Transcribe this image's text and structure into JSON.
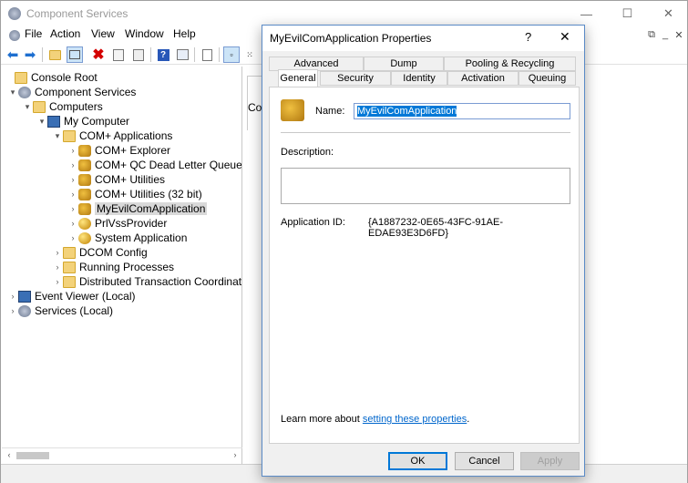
{
  "window": {
    "title": "Component Services",
    "menu": [
      "File",
      "Action",
      "View",
      "Window",
      "Help"
    ]
  },
  "tree": [
    {
      "label": "Console Root",
      "icon": "folder-icon",
      "exp": ""
    },
    {
      "label": "Component Services",
      "icon": "gear-icon",
      "exp": "▾"
    },
    {
      "label": "Computers",
      "icon": "folder-icon",
      "exp": "▾"
    },
    {
      "label": "My Computer",
      "icon": "computer-icon",
      "exp": "▾"
    },
    {
      "label": "COM+ Applications",
      "icon": "folder-icon",
      "exp": "▾"
    },
    {
      "label": "COM+ Explorer",
      "icon": "component-icon",
      "exp": "›"
    },
    {
      "label": "COM+ QC Dead Letter Queue Lis",
      "icon": "component-icon",
      "exp": "›"
    },
    {
      "label": "COM+ Utilities",
      "icon": "component-icon",
      "exp": "›"
    },
    {
      "label": "COM+ Utilities (32 bit)",
      "icon": "component-icon",
      "exp": "›"
    },
    {
      "label": "MyEvilComApplication",
      "icon": "component-icon",
      "exp": "›"
    },
    {
      "label": "PrlVssProvider",
      "icon": "ball-icon",
      "exp": "›"
    },
    {
      "label": "System Application",
      "icon": "ball-icon",
      "exp": "›"
    },
    {
      "label": "DCOM Config",
      "icon": "folder-icon",
      "exp": "›"
    },
    {
      "label": "Running Processes",
      "icon": "folder-icon",
      "exp": "›"
    },
    {
      "label": "Distributed Transaction Coordinator",
      "icon": "folder-icon",
      "exp": "›"
    },
    {
      "label": "Event Viewer (Local)",
      "icon": "event-viewer-icon",
      "exp": "›"
    },
    {
      "label": "Services (Local)",
      "icon": "gear-icon",
      "exp": "›"
    }
  ],
  "right_pane": {
    "column_fragment": "Cor"
  },
  "dialog": {
    "title": "MyEvilComApplication Properties",
    "help": "?",
    "close": "✕",
    "tabs_back": [
      "Advanced",
      "Dump",
      "Pooling & Recycling"
    ],
    "tabs_front": [
      "General",
      "Security",
      "Identity",
      "Activation",
      "Queuing"
    ],
    "name_label": "Name:",
    "name_value": "MyEvilComApplication",
    "description_label": "Description:",
    "description_value": "",
    "app_id_label": "Application ID:",
    "app_id_value": "{A1887232-0E65-43FC-91AE-EDAE93E3D6FD}",
    "learn_text": "Learn more about ",
    "learn_link": "setting these properties",
    "learn_end": ".",
    "buttons": {
      "ok": "OK",
      "cancel": "Cancel",
      "apply": "Apply"
    }
  }
}
